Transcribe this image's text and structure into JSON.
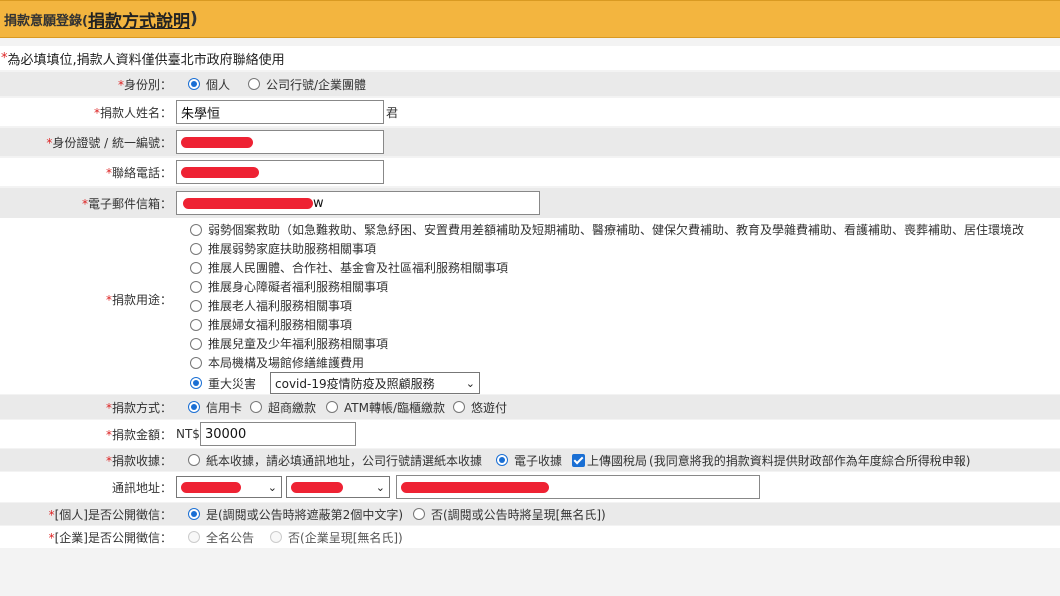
{
  "header": {
    "prefix": "捐款意願登錄(",
    "link": "捐款方式說明",
    "suffix": ")"
  },
  "note": {
    "star": "*",
    "text": "為必填填位,捐款人資料僅供臺北市政府聯絡使用"
  },
  "identity": {
    "label": "身份別：",
    "options": [
      "個人",
      "公司行號/企業團體"
    ],
    "selected": "個人"
  },
  "name": {
    "label": "捐款人姓名：",
    "value": "朱學恒",
    "suffix": "君"
  },
  "id_number": {
    "label": "身份證號 / 統一編號："
  },
  "phone": {
    "label": "聯絡電話："
  },
  "email": {
    "label": "電子郵件信箱：",
    "visible_tail": "w"
  },
  "purpose": {
    "label": "捐款用途：",
    "options": [
      "弱勢個案救助（如急難救助、緊急紓困、安置費用差額補助及短期補助、醫療補助、健保欠費補助、教育及學雜費補助、看護補助、喪葬補助、居住環境改",
      "推展弱勢家庭扶助服務相關事項",
      "推展人民團體、合作社、基金會及社區福利服務相關事項",
      "推展身心障礙者福利服務相關事項",
      "推展老人福利服務相關事項",
      "推展婦女福利服務相關事項",
      "推展兒童及少年福利服務相關事項",
      "本局機構及場館修繕維護費用",
      "重大災害"
    ],
    "selected_index": 8,
    "disaster_select": "covid-19疫情防疫及照顧服務"
  },
  "method": {
    "label": "捐款方式：",
    "options": [
      "信用卡",
      "超商繳款",
      "ATM轉帳/臨櫃繳款",
      "悠遊付"
    ],
    "selected": "信用卡"
  },
  "amount": {
    "label": "捐款金額：",
    "prefix": "NT$",
    "value": "30000"
  },
  "receipt": {
    "label": "捐款收據：",
    "paper": "紙本收據，請必填通訊地址，公司行號請選紙本收據",
    "electronic": "電子收據",
    "upload": "上傳國稅局",
    "upload_note": "(我同意將我的捐款資料提供財政部作為年度綜合所得稅申報)",
    "selected": "電子收據",
    "upload_checked": true
  },
  "address": {
    "label": "通訊地址："
  },
  "personal_public": {
    "label": "[個人]是否公開徵信：",
    "options": [
      "是(調閱或公告時將遮蔽第2個中文字)",
      "否(調閱或公告時將呈現[無名氏])"
    ],
    "selected": 0
  },
  "company_public": {
    "label": "[企業]是否公開徵信：",
    "options": [
      "全名公告",
      "否(企業呈現[無名氏])"
    ]
  },
  "colors": {
    "header_bg": "#f3b53f",
    "required": "#d22222",
    "accent": "#1a6fd4",
    "redaction": "#ee2233"
  }
}
